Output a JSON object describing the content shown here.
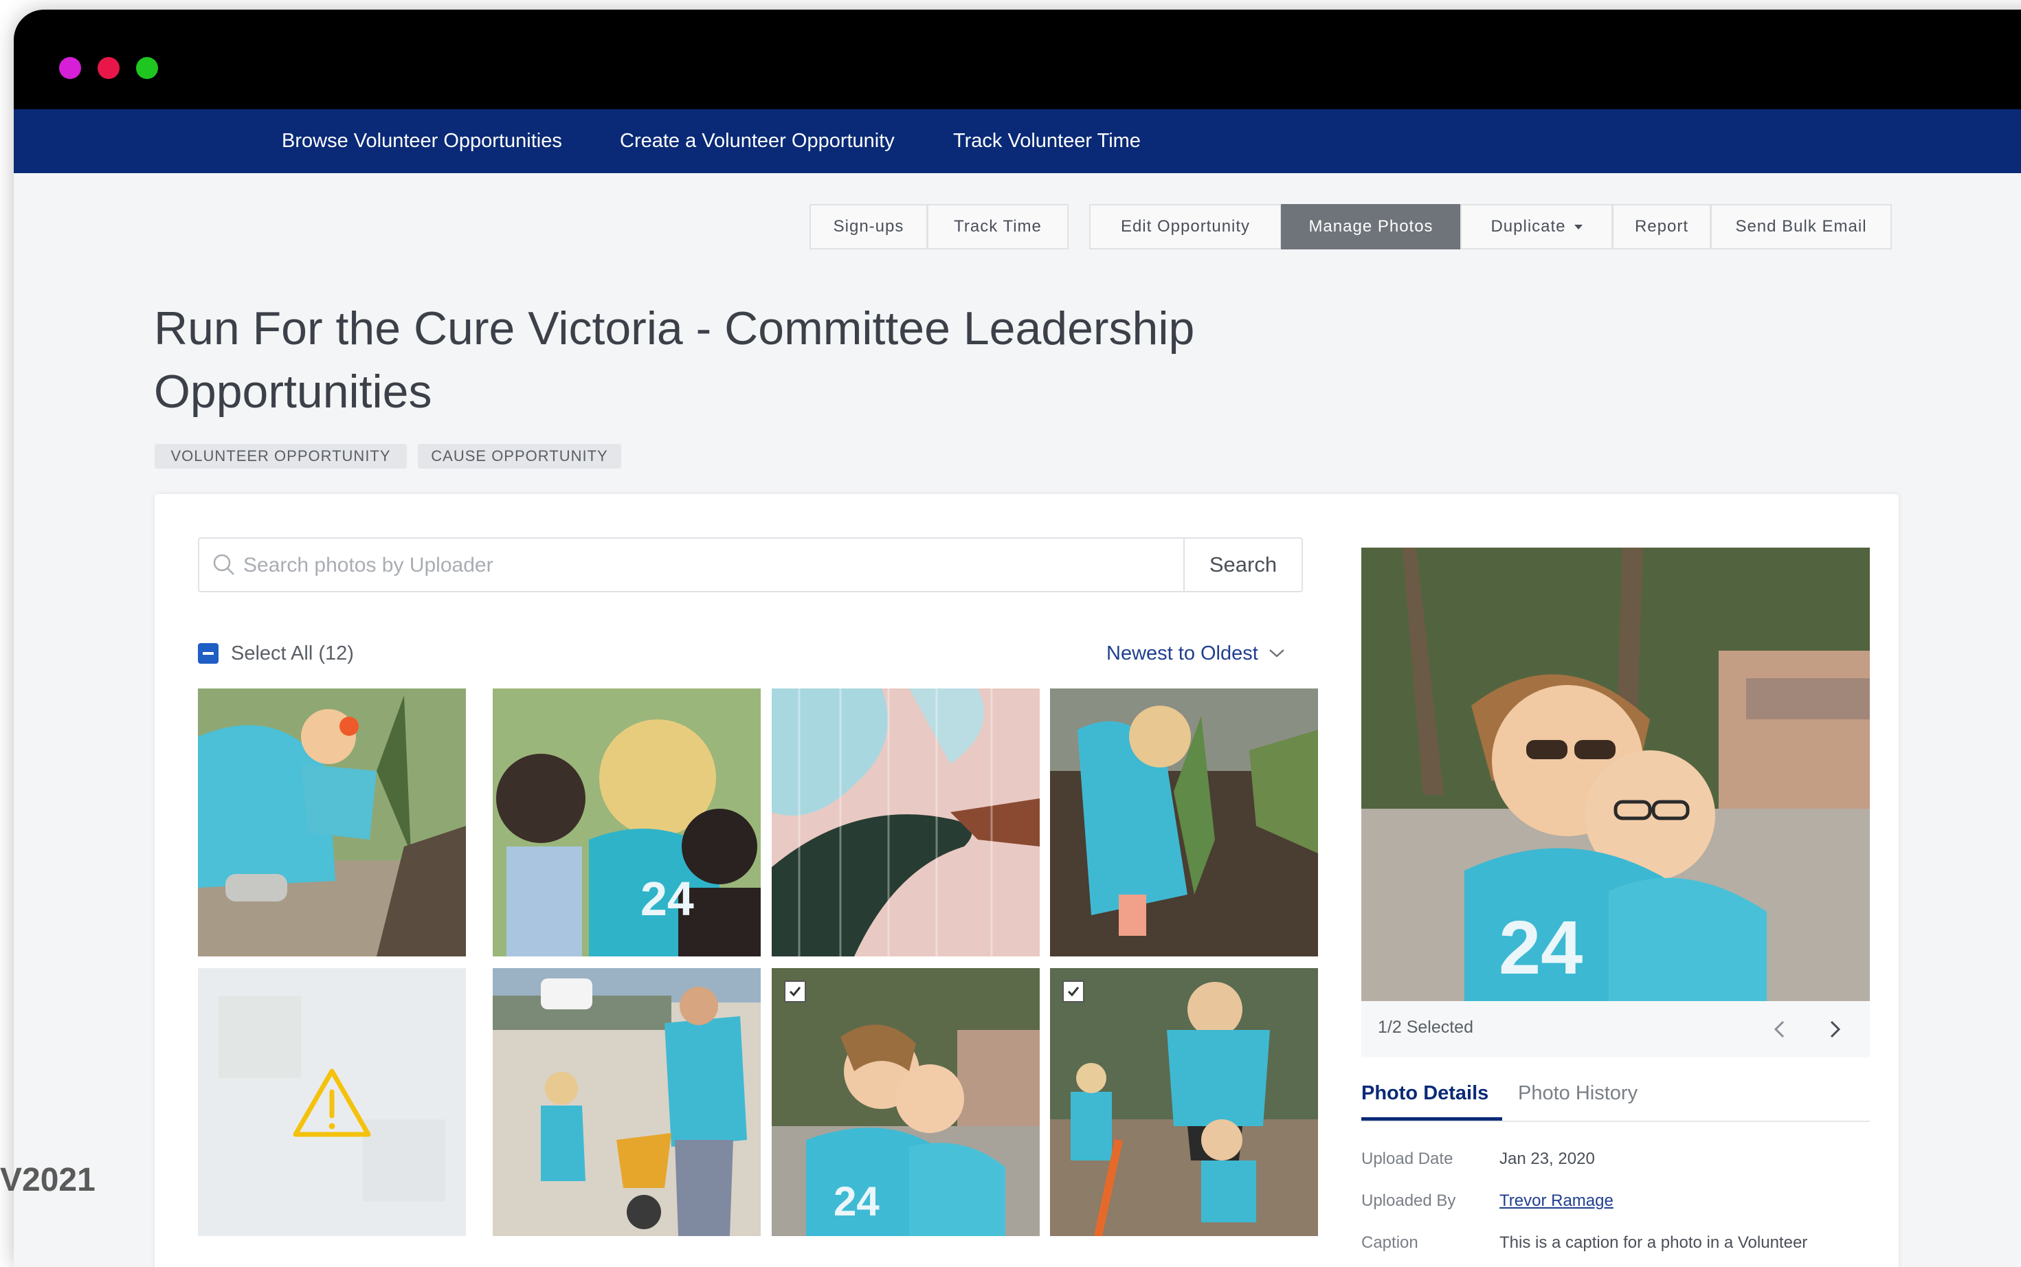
{
  "window": {
    "traffic_lights": [
      "#d61fd6",
      "#e8174a",
      "#1fc61f"
    ]
  },
  "nav": {
    "links": [
      "Browse Volunteer Opportunities",
      "Create a Volunteer Opportunity",
      "Track Volunteer Time"
    ]
  },
  "actions": {
    "signups": "Sign-ups",
    "track_time": "Track Time",
    "edit": "Edit Opportunity",
    "manage_photos": "Manage Photos",
    "duplicate": "Duplicate",
    "report": "Report",
    "bulk_email": "Send Bulk Email"
  },
  "page": {
    "title_line1": "Run For the Cure Victoria - Committee Leadership",
    "title_line2": "Opportunities",
    "tags": [
      "VOLUNTEER OPPORTUNITY",
      "CAUSE OPPORTUNITY"
    ]
  },
  "search": {
    "placeholder": "Search photos by Uploader",
    "button": "Search"
  },
  "toolbar": {
    "select_all": "Select All (12)",
    "sort": "Newest to Oldest"
  },
  "gallery": {
    "photos": [
      {
        "desc": "child-planting",
        "selected": false
      },
      {
        "desc": "volunteers-group",
        "selected": false
      },
      {
        "desc": "painting-wall",
        "selected": false
      },
      {
        "desc": "child-garden",
        "selected": false
      },
      {
        "desc": "broken-image",
        "selected": false
      },
      {
        "desc": "wheelbarrow",
        "selected": false
      },
      {
        "desc": "two-women",
        "selected": true
      },
      {
        "desc": "mother-child",
        "selected": true
      }
    ]
  },
  "preview": {
    "selected_count": "1/2 Selected"
  },
  "details": {
    "tab_details": "Photo Details",
    "tab_history": "Photo History",
    "upload_date_label": "Upload Date",
    "upload_date": "Jan 23, 2020",
    "uploaded_by_label": "Uploaded By",
    "uploaded_by": "Trevor Ramage",
    "caption_label": "Caption",
    "caption": "This is a caption for a photo in a Volunteer"
  },
  "watermark": "V2021",
  "colors": {
    "nav_bg": "#0a2a77",
    "accent": "#1f5ec4",
    "active_button": "#6f737a"
  }
}
